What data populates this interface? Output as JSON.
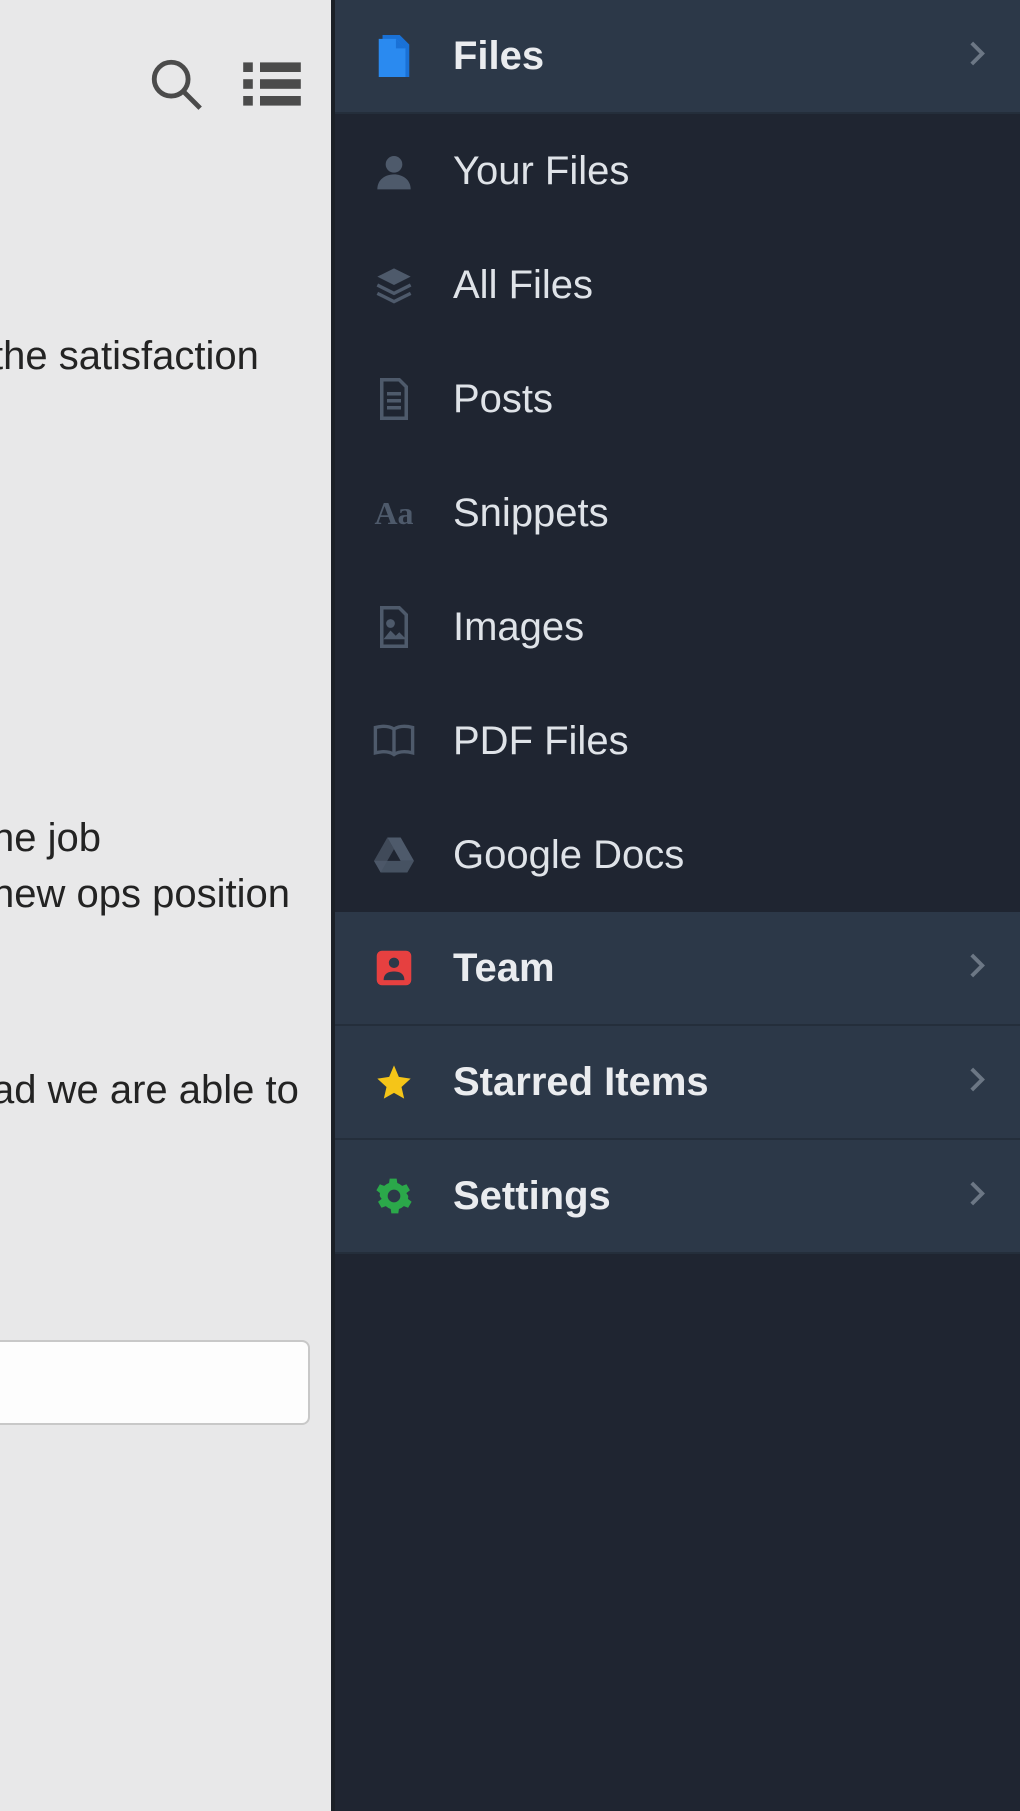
{
  "left": {
    "fragments": {
      "line1": "the satisfaction",
      "line2": "ne job",
      "line3": "new ops position",
      "line4": "ad we are able to"
    }
  },
  "sidebar": {
    "sections": {
      "files": {
        "label": "Files",
        "items": [
          {
            "label": "Your Files"
          },
          {
            "label": "All Files"
          },
          {
            "label": "Posts"
          },
          {
            "label": "Snippets"
          },
          {
            "label": "Images"
          },
          {
            "label": "PDF Files"
          },
          {
            "label": "Google Docs"
          }
        ]
      },
      "team": {
        "label": "Team"
      },
      "starred": {
        "label": "Starred Items"
      },
      "settings": {
        "label": "Settings"
      }
    }
  }
}
